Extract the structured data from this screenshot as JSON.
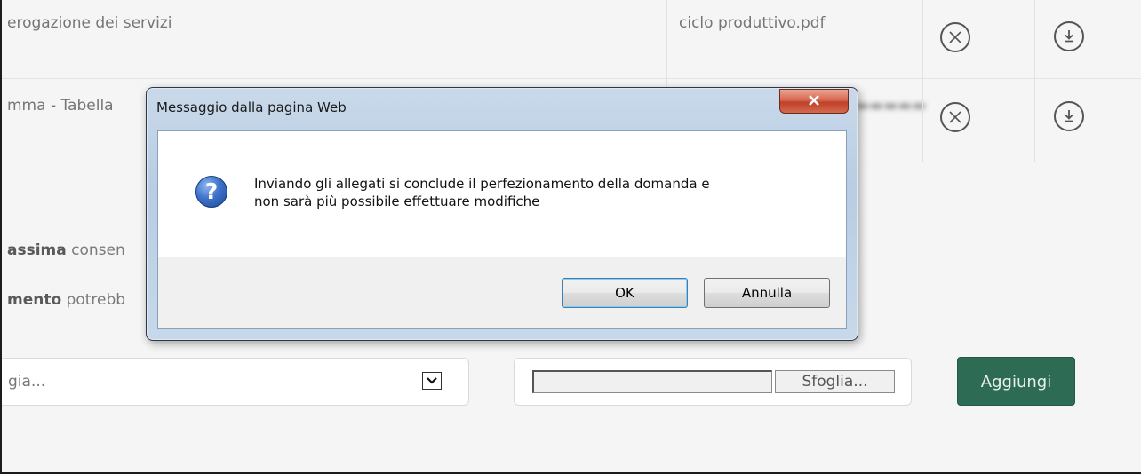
{
  "table": {
    "rows": [
      {
        "description": "erogazione dei servizi",
        "filename": "ciclo produttivo.pdf"
      },
      {
        "description": "mma - Tabella",
        "filename": ""
      }
    ]
  },
  "info": {
    "line1_bold": "assima",
    "line1_rest": " consen",
    "line2_bold": "mento",
    "line2_rest": " potrebb"
  },
  "form": {
    "select_value": "gia...",
    "browse_label": "Sfoglia...",
    "add_label": "Aggiungi"
  },
  "dialog": {
    "title": "Messaggio dalla pagina Web",
    "message_line1": "Inviando gli allegati si conclude il perfezionamento della domanda e",
    "message_line2": "non sarà più possibile effettuare modifiche",
    "ok_label": "OK",
    "cancel_label": "Annulla",
    "question_glyph": "?"
  },
  "colors": {
    "add_button": "#2e6b55",
    "close_button": "#c94a33"
  }
}
